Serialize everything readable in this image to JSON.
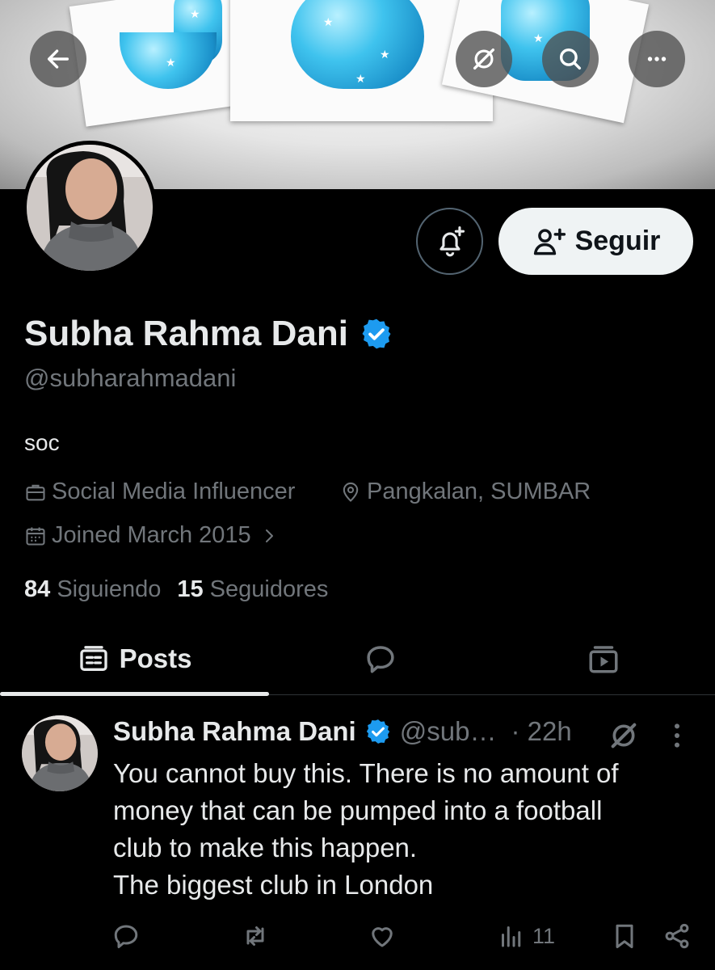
{
  "colors": {
    "background": "#000000",
    "text": "#e7e9ea",
    "muted": "#71767b",
    "verified": "#1d9bf0",
    "follow_bg": "#eff3f4"
  },
  "header": {
    "icons": [
      "back-arrow-icon",
      "grok-icon",
      "search-icon",
      "more-icon"
    ]
  },
  "profile": {
    "display_name": "Subha Rahma Dani",
    "handle": "@subharahmadani",
    "bio": "soc",
    "profession": "Social Media Influencer",
    "location": "Pangkalan, SUMBAR",
    "joined": "Joined March 2015",
    "following_count": "84",
    "following_label": "Siguiendo",
    "followers_count": "15",
    "followers_label": "Seguidores",
    "follow_label": "Seguir"
  },
  "tabs": [
    {
      "label": "Posts",
      "icon": "posts-icon",
      "active": true
    },
    {
      "label": "",
      "icon": "replies-icon",
      "active": false
    },
    {
      "label": "",
      "icon": "media-icon",
      "active": false
    }
  ],
  "post": {
    "author": "Subha Rahma Dani",
    "handle": "@sub…",
    "time": "· 22h",
    "lines": [
      "You cannot buy this. There is no amount of",
      "money that can be pumped into a football",
      "club to make this happen.",
      "The biggest club in London"
    ],
    "views": "11"
  }
}
